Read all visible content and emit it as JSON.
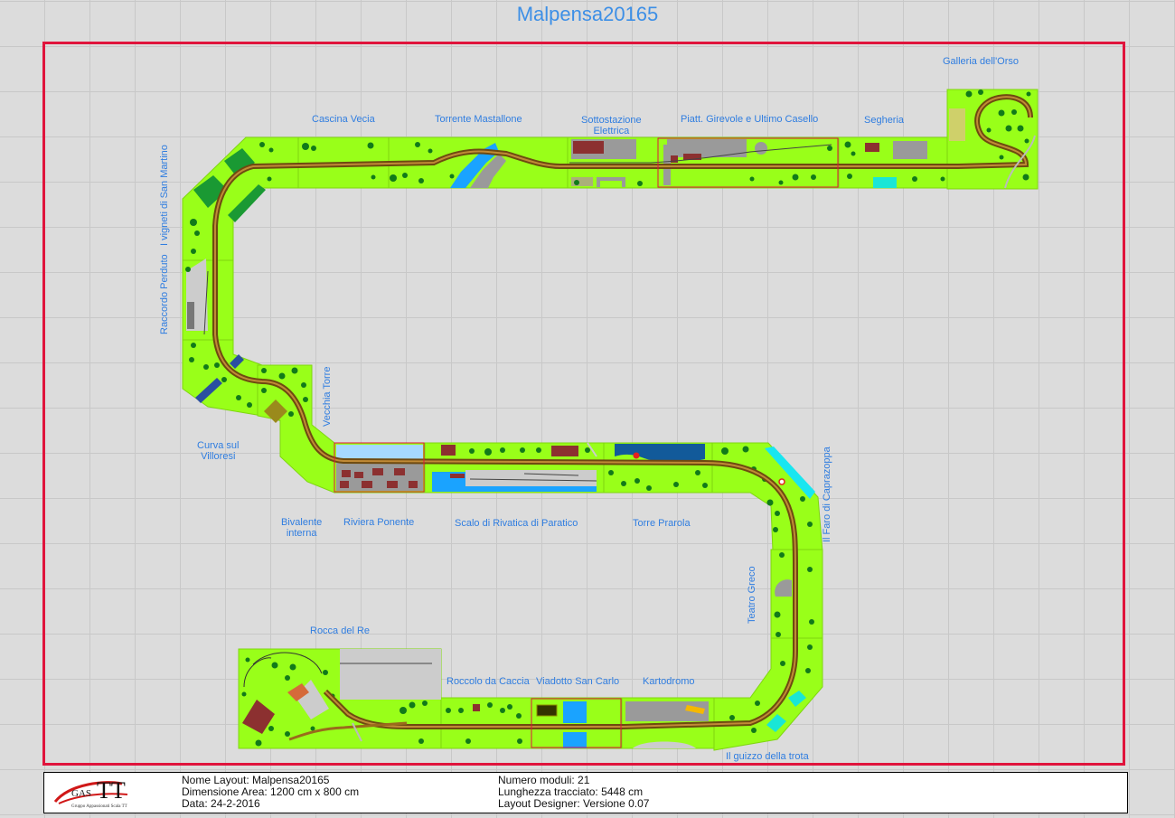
{
  "title": "Malpensa20165",
  "labels": {
    "galleria": "Galleria dell'Orso",
    "cascina": "Cascina Vecia",
    "torrente": "Torrente Mastallone",
    "sottostazione_1": "Sottostazione",
    "sottostazione_2": "Elettrica",
    "piatt": "Piatt. Girevole e Ultimo Casello",
    "segheria": "Segheria",
    "vigneti": "I vigneti di San Martino",
    "raccordo": "Raccordo Perduto",
    "vecchia_torre": "Vecchia Torre",
    "curva_1": "Curva sul",
    "curva_2": "Villoresi",
    "bivalente_1": "Bivalente",
    "bivalente_2": "interna",
    "riviera": "Riviera Ponente",
    "scalo": "Scalo di Rivatica di Paratico",
    "torre_prarola": "Torre Prarola",
    "faro": "Il Faro di Caprazoppa",
    "teatro": "Teatro Greco",
    "rocca": "Rocca del Re",
    "roccolo": "Roccolo da Caccia",
    "viadotto": "Viadotto San Carlo",
    "kartodromo": "Kartodromo",
    "guizzo": "Il guizzo della trota"
  },
  "info": {
    "nome": "Nome Layout: Malpensa20165",
    "dimensione": "Dimensione Area: 1200 cm x 800 cm",
    "data": "Data: 24-2-2016",
    "moduli": "Numero moduli: 21",
    "lunghezza": "Lunghezza tracciato: 5448 cm",
    "designer": "Layout Designer: Versione 0.07"
  },
  "logo": {
    "gas": "GAS",
    "tt": "TT",
    "subtitle": "Gruppo Appassionati Scala TT"
  },
  "colors": {
    "module": "#99ff19",
    "track": "#9a6a1c",
    "border": "#e0143c",
    "label": "#2f7de0",
    "title": "#3d8fe6",
    "tree": "#117a1a",
    "water": "#1aa3ff"
  }
}
